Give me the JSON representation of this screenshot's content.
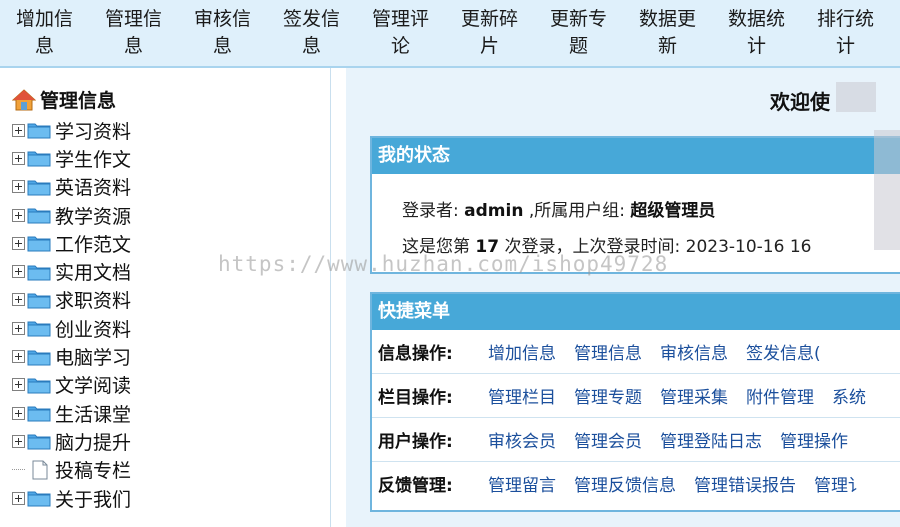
{
  "topnav": [
    {
      "line1": "增加信",
      "line2": "息"
    },
    {
      "line1": "管理信",
      "line2": "息"
    },
    {
      "line1": "审核信",
      "line2": "息"
    },
    {
      "line1": "签发信",
      "line2": "息"
    },
    {
      "line1": "管理评",
      "line2": "论"
    },
    {
      "line1": "更新碎",
      "line2": "片"
    },
    {
      "line1": "更新专",
      "line2": "题"
    },
    {
      "line1": "数据更",
      "line2": "新"
    },
    {
      "line1": "数据统",
      "line2": "计"
    },
    {
      "line1": "排行统",
      "line2": "计"
    }
  ],
  "sidebar": {
    "root_label": "管理信息",
    "items": [
      {
        "label": "学习资料",
        "type": "folder"
      },
      {
        "label": "学生作文",
        "type": "folder"
      },
      {
        "label": "英语资料",
        "type": "folder"
      },
      {
        "label": "教学资源",
        "type": "folder"
      },
      {
        "label": "工作范文",
        "type": "folder"
      },
      {
        "label": "实用文档",
        "type": "folder"
      },
      {
        "label": "求职资料",
        "type": "folder"
      },
      {
        "label": "创业资料",
        "type": "folder"
      },
      {
        "label": "电脑学习",
        "type": "folder"
      },
      {
        "label": "文学阅读",
        "type": "folder"
      },
      {
        "label": "生活课堂",
        "type": "folder"
      },
      {
        "label": "脑力提升",
        "type": "folder"
      },
      {
        "label": "投稿专栏",
        "type": "doc"
      },
      {
        "label": "关于我们",
        "type": "folder"
      }
    ]
  },
  "main": {
    "welcome": "欢迎使",
    "status": {
      "title": "我的状态",
      "login_prefix": "登录者:",
      "username": "admin",
      "group_prefix": ",所属用户组:",
      "group": "超级管理员",
      "count_prefix": "这是您第",
      "count": "17",
      "count_suffix": "次登录，上次登录时间:",
      "last_login": "2023-10-16 16"
    },
    "quick": {
      "title": "快捷菜单",
      "rows": [
        {
          "label": "信息操作:",
          "links": [
            "增加信息",
            "管理信息",
            "审核信息",
            "签发信息("
          ]
        },
        {
          "label": "栏目操作:",
          "links": [
            "管理栏目",
            "管理专题",
            "管理采集",
            "附件管理",
            "系统"
          ]
        },
        {
          "label": "用户操作:",
          "links": [
            "审核会员",
            "管理会员",
            "管理登陆日志",
            "管理操作"
          ]
        },
        {
          "label": "反馈管理:",
          "links": [
            "管理留言",
            "管理反馈信息",
            "管理错误报告",
            "管理讠"
          ]
        }
      ]
    }
  },
  "watermark": "https://www.huzhan.com/ishop49728",
  "colors": {
    "nav_bg": "#dff0fb",
    "panel_title": "#47a8d8",
    "link": "#1b4f9c",
    "main_bg": "#e8f3fb"
  }
}
